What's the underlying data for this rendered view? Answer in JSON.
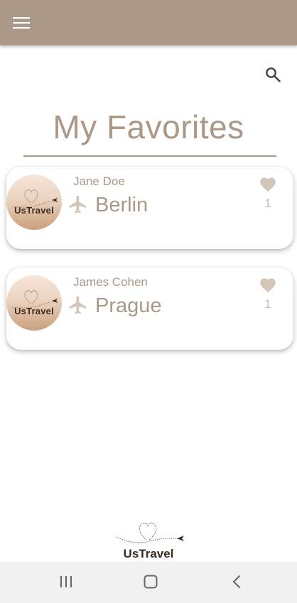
{
  "header": {
    "menu_icon": "hamburger-menu-icon"
  },
  "toolbar": {
    "search_icon": "search-icon"
  },
  "page": {
    "title": "My Favorites"
  },
  "brand": {
    "name": "UsTravel"
  },
  "favorites": [
    {
      "user": "Jane Doe",
      "destination": "Berlin",
      "likes": "1",
      "avatar_text": "UsTravel"
    },
    {
      "user": "James Cohen",
      "destination": "Prague",
      "likes": "1",
      "avatar_text": "UsTravel"
    }
  ],
  "colors": {
    "accent": "#ac9887",
    "appbar": "#ac9887",
    "heart": "#d4c5b9",
    "navbar": "#f1f1f1"
  },
  "system_nav": {
    "recents_icon": "recents-icon",
    "home_icon": "home-icon",
    "back_icon": "back-icon"
  }
}
